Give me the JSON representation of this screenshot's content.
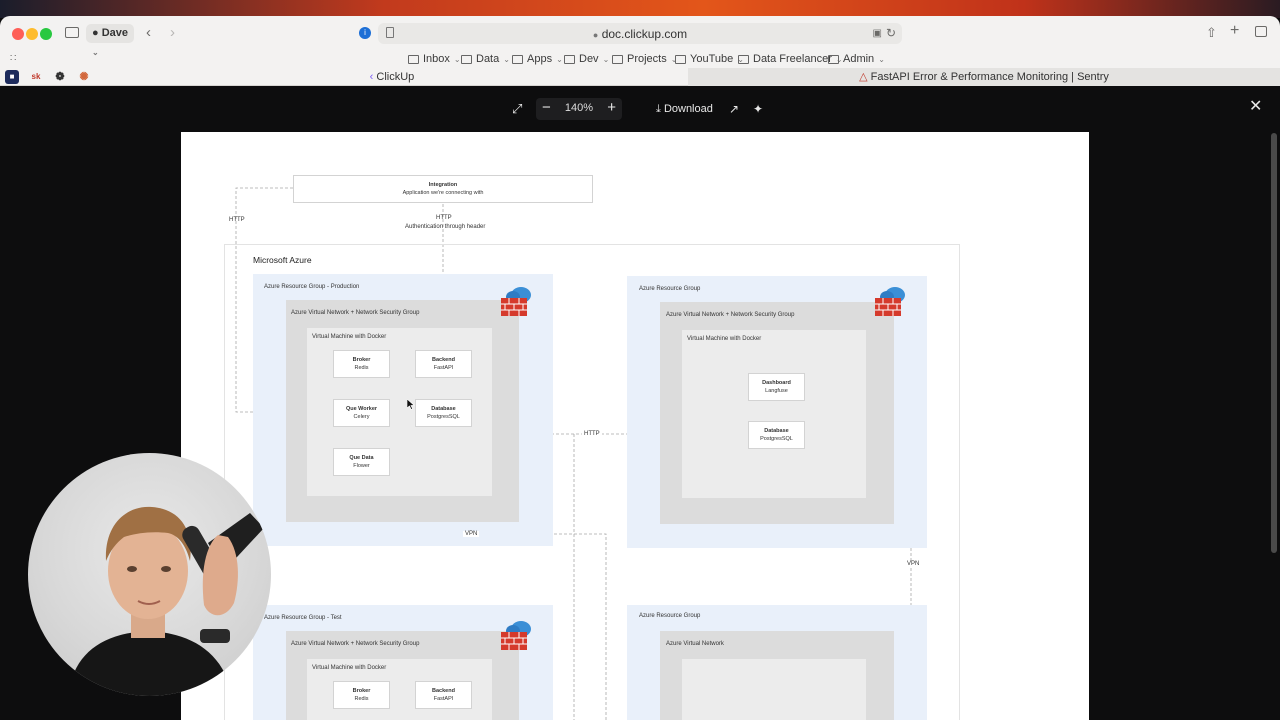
{
  "browser": {
    "profile": "Dave",
    "url": "doc.clickup.com",
    "bookmarks": [
      "Inbox",
      "Data",
      "Apps",
      "Dev",
      "Projects",
      "YouTube",
      "Data Freelancer",
      "Admin"
    ],
    "pinned_tabs": [
      "sk"
    ],
    "tabs": [
      {
        "label": "ClickUp",
        "active": true
      },
      {
        "label": "FastAPI Error & Performance Monitoring | Sentry",
        "active": false
      }
    ]
  },
  "viewer": {
    "zoom": "140%",
    "download_label": "Download"
  },
  "diagram": {
    "integration": {
      "title": "Integration",
      "subtitle": "Application we're connecting with"
    },
    "http_left": "HTTP",
    "http_top": "HTTP",
    "auth_note": "Authentication through header",
    "azure_title": "Microsoft Azure",
    "http_middle": "HTTP",
    "vpn_bottom": "VPN",
    "vpn_right": "VPN",
    "rg_production": {
      "title": "Azure Resource Group - Production",
      "vnet": "Azure Virtual Network + Network Security Group",
      "vm": "Virtual Machine with Docker",
      "nodes": {
        "broker": {
          "t": "Broker",
          "s": "Redis"
        },
        "backend": {
          "t": "Backend",
          "s": "FastAPI"
        },
        "worker": {
          "t": "Que Worker",
          "s": "Celery"
        },
        "database": {
          "t": "Database",
          "s": "PostgresSQL"
        },
        "quedata": {
          "t": "Que Data",
          "s": "Flower"
        }
      }
    },
    "rg_right": {
      "title": "Azure Resource Group",
      "vnet": "Azure Virtual Network + Network Security Group",
      "vm": "Virtual Machine with Docker",
      "nodes": {
        "dashboard": {
          "t": "Dashboard",
          "s": "Langfuse"
        },
        "database": {
          "t": "Database",
          "s": "PostgresSQL"
        }
      }
    },
    "rg_test": {
      "title": "Azure Resource Group - Test",
      "vnet": "Azure Virtual Network + Network Security Group",
      "vm": "Virtual Machine with Docker",
      "nodes": {
        "broker": {
          "t": "Broker",
          "s": "Redis"
        },
        "backend": {
          "t": "Backend",
          "s": "FastAPI"
        }
      }
    },
    "rg_bottom_right": {
      "title": "Azure Resource Group",
      "vnet": "Azure Virtual Network"
    }
  }
}
